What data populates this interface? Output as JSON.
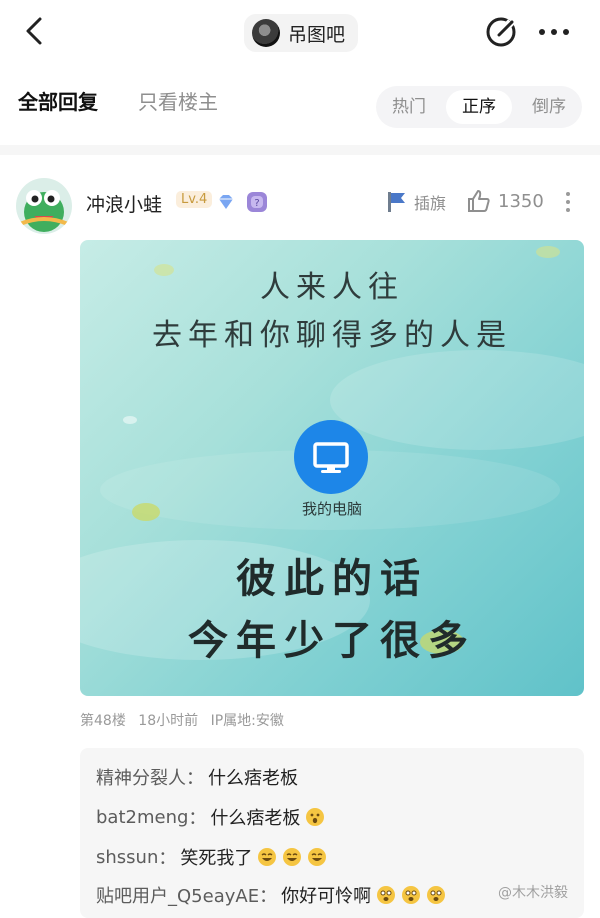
{
  "header": {
    "forum_name": "吊图吧"
  },
  "filters": {
    "all_replies": "全部回复",
    "only_op": "只看楼主",
    "sort_hot": "热门",
    "sort_asc": "正序",
    "sort_desc": "倒序",
    "active_sort": "正序"
  },
  "post": {
    "username": "冲浪小蛙",
    "level": "Lv.4",
    "flag_label": "插旗",
    "like_count": "1350",
    "image": {
      "line1": "人来人往",
      "line2": "去年和你聊得多的人是",
      "pc_label": "我的电脑",
      "big1": "彼此的话",
      "big2": "今年少了很多"
    },
    "meta": {
      "floor": "第48楼",
      "time": "18小时前",
      "ip": "IP属地:安徽"
    }
  },
  "replies": [
    {
      "author": "精神分裂人",
      "text": "什么痞老板",
      "emoji_count": 0
    },
    {
      "author": "bat2meng",
      "text": "什么痞老板",
      "emoji_count": 1
    },
    {
      "author": "shssun",
      "text": "笑死我了",
      "emoji_count": 3
    },
    {
      "author": "贴吧用户_Q5eayAE",
      "text": "你好可怜啊",
      "emoji_count": 3
    }
  ],
  "watermark": "@木木洪毅",
  "colors": {
    "accent_blue": "#1d86e8",
    "level_gold": "#c79a3d",
    "muted_text": "#8f8f8f"
  },
  "icons": {
    "back": "chevron-left-icon",
    "edit": "edit-icon",
    "more": "more-horizontal-icon",
    "flag": "flag-icon",
    "like": "thumbs-up-icon",
    "pc": "monitor-icon"
  }
}
